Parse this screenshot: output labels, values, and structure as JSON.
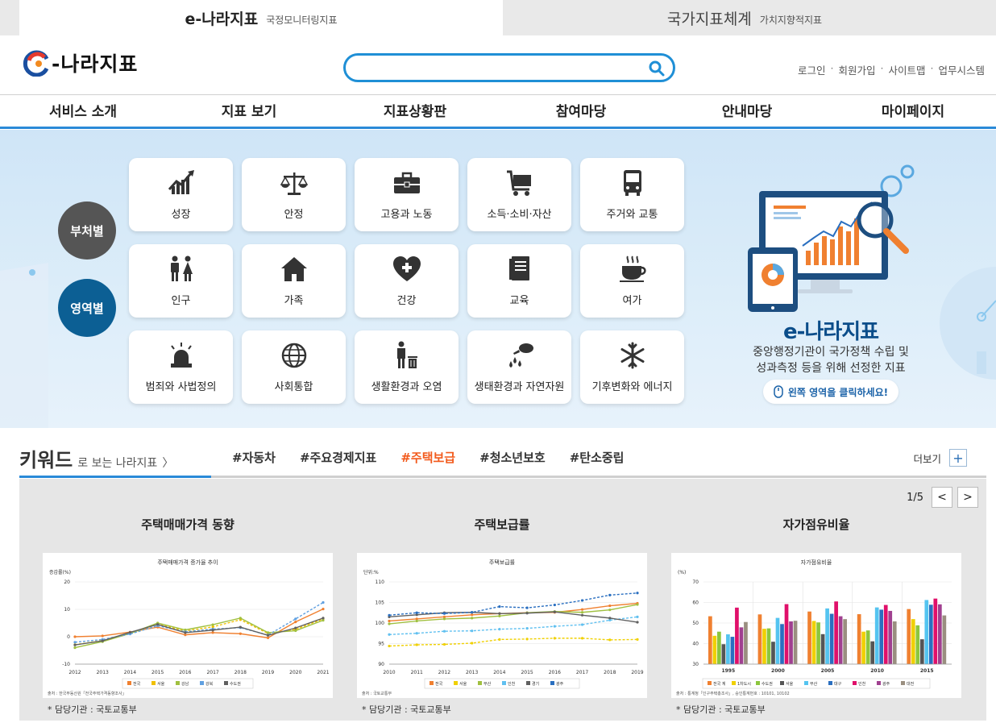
{
  "top_tabs": [
    {
      "main": "e-나라지표",
      "sub": "국정모니터링지표"
    },
    {
      "main": "국가지표체계",
      "sub": "가치지향적지표"
    }
  ],
  "logo": {
    "text": "-나라지표"
  },
  "search": {
    "placeholder": "",
    "value": ""
  },
  "util_links": [
    "로그인",
    "회원가입",
    "사이트맵",
    "업무시스템"
  ],
  "util_sep": "·",
  "gnb": [
    "서비스 소개",
    "지표 보기",
    "지표상황판",
    "참여마당",
    "안내마당",
    "마이페이지"
  ],
  "hero": {
    "buttons": [
      "부처별",
      "영역별"
    ],
    "categories": [
      {
        "label": "성장",
        "icon": "growth-chart-icon"
      },
      {
        "label": "안정",
        "icon": "scale-icon"
      },
      {
        "label": "고용과 노동",
        "icon": "briefcase-icon"
      },
      {
        "label": "소득·소비·자산",
        "icon": "cart-icon"
      },
      {
        "label": "주거와 교통",
        "icon": "bus-icon"
      },
      {
        "label": "인구",
        "icon": "people-icon"
      },
      {
        "label": "가족",
        "icon": "house-icon"
      },
      {
        "label": "건강",
        "icon": "health-heart-icon"
      },
      {
        "label": "교육",
        "icon": "book-icon"
      },
      {
        "label": "여가",
        "icon": "coffee-cup-icon"
      },
      {
        "label": "범죄와 사법정의",
        "icon": "siren-icon"
      },
      {
        "label": "사회통합",
        "icon": "globe-icon"
      },
      {
        "label": "생활환경과 오염",
        "icon": "trash-person-icon"
      },
      {
        "label": "생태환경과 자연자원",
        "icon": "watering-icon"
      },
      {
        "label": "기후변화와 에너지",
        "icon": "snowflake-icon"
      }
    ],
    "promo_title": "e-나라지표",
    "promo_desc1": "중앙행정기관이 국가정책 수립 및",
    "promo_desc2": "성과측정 등을 위해 선정한 지표",
    "promo_button": "왼쪽 영역을 클릭하세요!"
  },
  "keywords": {
    "title": "키워드",
    "subtitle": "로 보는 나라지표",
    "arrow": "〉",
    "tags": [
      "#자동차",
      "#주요경제지표",
      "#주택보급",
      "#청소년보호",
      "#탄소중립"
    ],
    "active_index": 2,
    "more_label": "더보기",
    "pager": "1/5"
  },
  "cards": [
    {
      "title": "주택매매가격 동향",
      "source_note": "* 담당기관 : 국토교통부"
    },
    {
      "title": "주택보급률",
      "source_note": "* 담당기관 : 국토교통부"
    },
    {
      "title": "자가점유비율",
      "source_note": "* 담당기관 : 국토교통부"
    }
  ],
  "chart_data": [
    {
      "type": "line",
      "title": "주택매매가격 증가율 추이",
      "ylabel": "증감률(%)",
      "x": [
        "2012",
        "2013",
        "2014",
        "2015",
        "2016",
        "2017",
        "2018",
        "2019",
        "2020",
        "2021"
      ],
      "ylim": [
        -10,
        20
      ],
      "yticks": [
        -10,
        0,
        10,
        20
      ],
      "series": [
        {
          "name": "전국",
          "color": "#f08030",
          "values": [
            0,
            0.3,
            1.7,
            3.5,
            0.7,
            1.5,
            1.1,
            -0.4,
            5.4,
            10.1
          ]
        },
        {
          "name": "서울",
          "color": "#f0c000",
          "values": [
            -2.9,
            -1.4,
            1.1,
            4.6,
            2.1,
            3.6,
            6.2,
            1.2,
            2.7,
            6.5
          ]
        },
        {
          "name": "강남",
          "color": "#a0c040",
          "values": [
            -4,
            -1.8,
            1.2,
            5,
            2.5,
            4.4,
            6.8,
            1.5,
            2.2,
            6
          ]
        },
        {
          "name": "강북",
          "color": "#60a0e0",
          "values": [
            -2,
            -1,
            1,
            4,
            1.8,
            2.8,
            3.3,
            0.6,
            6.5,
            12.5
          ]
        },
        {
          "name": "수도권",
          "color": "#606060",
          "values": [
            -3,
            -1.5,
            1.6,
            4.5,
            1.5,
            2.4,
            3.5,
            0.5,
            3.2,
            6.8
          ]
        }
      ],
      "source": "출처 : 한국부동산원「전국주택가격동향조사」"
    },
    {
      "type": "line",
      "title": "주택보급률",
      "ylabel": "단위:%",
      "x": [
        "2010",
        "2011",
        "2012",
        "2013",
        "2014",
        "2015",
        "2016",
        "2017",
        "2018",
        "2019"
      ],
      "ylim": [
        90,
        110
      ],
      "yticks": [
        90,
        95,
        100,
        105,
        110
      ],
      "series": [
        {
          "name": "전국",
          "color": "#f08030",
          "values": [
            100.5,
            101,
            101.5,
            102,
            102.3,
            102.5,
            102.6,
            103.3,
            104.2,
            104.8
          ]
        },
        {
          "name": "서울",
          "color": "#f0d000",
          "values": [
            94.4,
            94.7,
            94.8,
            95.1,
            96,
            96.1,
            96.3,
            96.3,
            95.9,
            96
          ]
        },
        {
          "name": "부산",
          "color": "#a0c040",
          "values": [
            99.8,
            100.5,
            101,
            101.2,
            101.7,
            102.5,
            102.8,
            102.6,
            103.2,
            104.5
          ]
        },
        {
          "name": "인천",
          "color": "#60c0f0",
          "values": [
            97.2,
            97.5,
            98,
            98.1,
            98.5,
            98.7,
            99.2,
            99.6,
            100.7,
            101.5
          ]
        },
        {
          "name": "경기",
          "color": "#606060",
          "values": [
            101.5,
            102,
            102.5,
            102.6,
            102.3,
            102.4,
            102.7,
            101.9,
            101.2,
            100.2
          ]
        },
        {
          "name": "광주",
          "color": "#2a6fc0",
          "values": [
            101.9,
            102.5,
            102.3,
            102.6,
            104,
            103.7,
            104.4,
            105.5,
            106.8,
            107.3
          ]
        }
      ],
      "source": "출처 : 국토교통부"
    },
    {
      "type": "bar",
      "title": "자가점유비율",
      "ylabel": "(%)",
      "categories": [
        "1995",
        "2000",
        "2005",
        "2010",
        "2015"
      ],
      "ylim": [
        30,
        70
      ],
      "yticks": [
        30,
        40,
        50,
        60,
        70
      ],
      "series": [
        {
          "name": "전국 계",
          "color": "#f08030",
          "values": [
            53.3,
            54.2,
            55.6,
            54.3,
            56.8
          ]
        },
        {
          "name": "1차도시",
          "color": "#f0d000",
          "values": [
            43.8,
            47.2,
            51,
            45.8,
            51.9
          ]
        },
        {
          "name": "수도권",
          "color": "#8cc63e",
          "values": [
            45.8,
            47.4,
            50.3,
            46.4,
            48.9
          ]
        },
        {
          "name": "서울",
          "color": "#555555",
          "values": [
            39.7,
            40.9,
            44.6,
            41.1,
            42.1
          ]
        },
        {
          "name": "부산",
          "color": "#54c4f0",
          "values": [
            44.5,
            52.5,
            57.1,
            57.6,
            61.2
          ]
        },
        {
          "name": "대구",
          "color": "#2a6fc0",
          "values": [
            43.3,
            49.5,
            54.5,
            56.5,
            58.9
          ]
        },
        {
          "name": "인천",
          "color": "#e0106a",
          "values": [
            57.5,
            59.2,
            60.5,
            58.8,
            61.9
          ]
        },
        {
          "name": "광주",
          "color": "#a04090",
          "values": [
            47.9,
            50.8,
            53.3,
            55.9,
            59.1
          ]
        },
        {
          "name": "대전",
          "color": "#9a8f80",
          "values": [
            50.5,
            51.1,
            51.9,
            50.8,
            53.7
          ]
        }
      ],
      "source": "출처 : 통계청「인구주택총조사」, 승인통계번호 : 10101, 10102"
    }
  ]
}
